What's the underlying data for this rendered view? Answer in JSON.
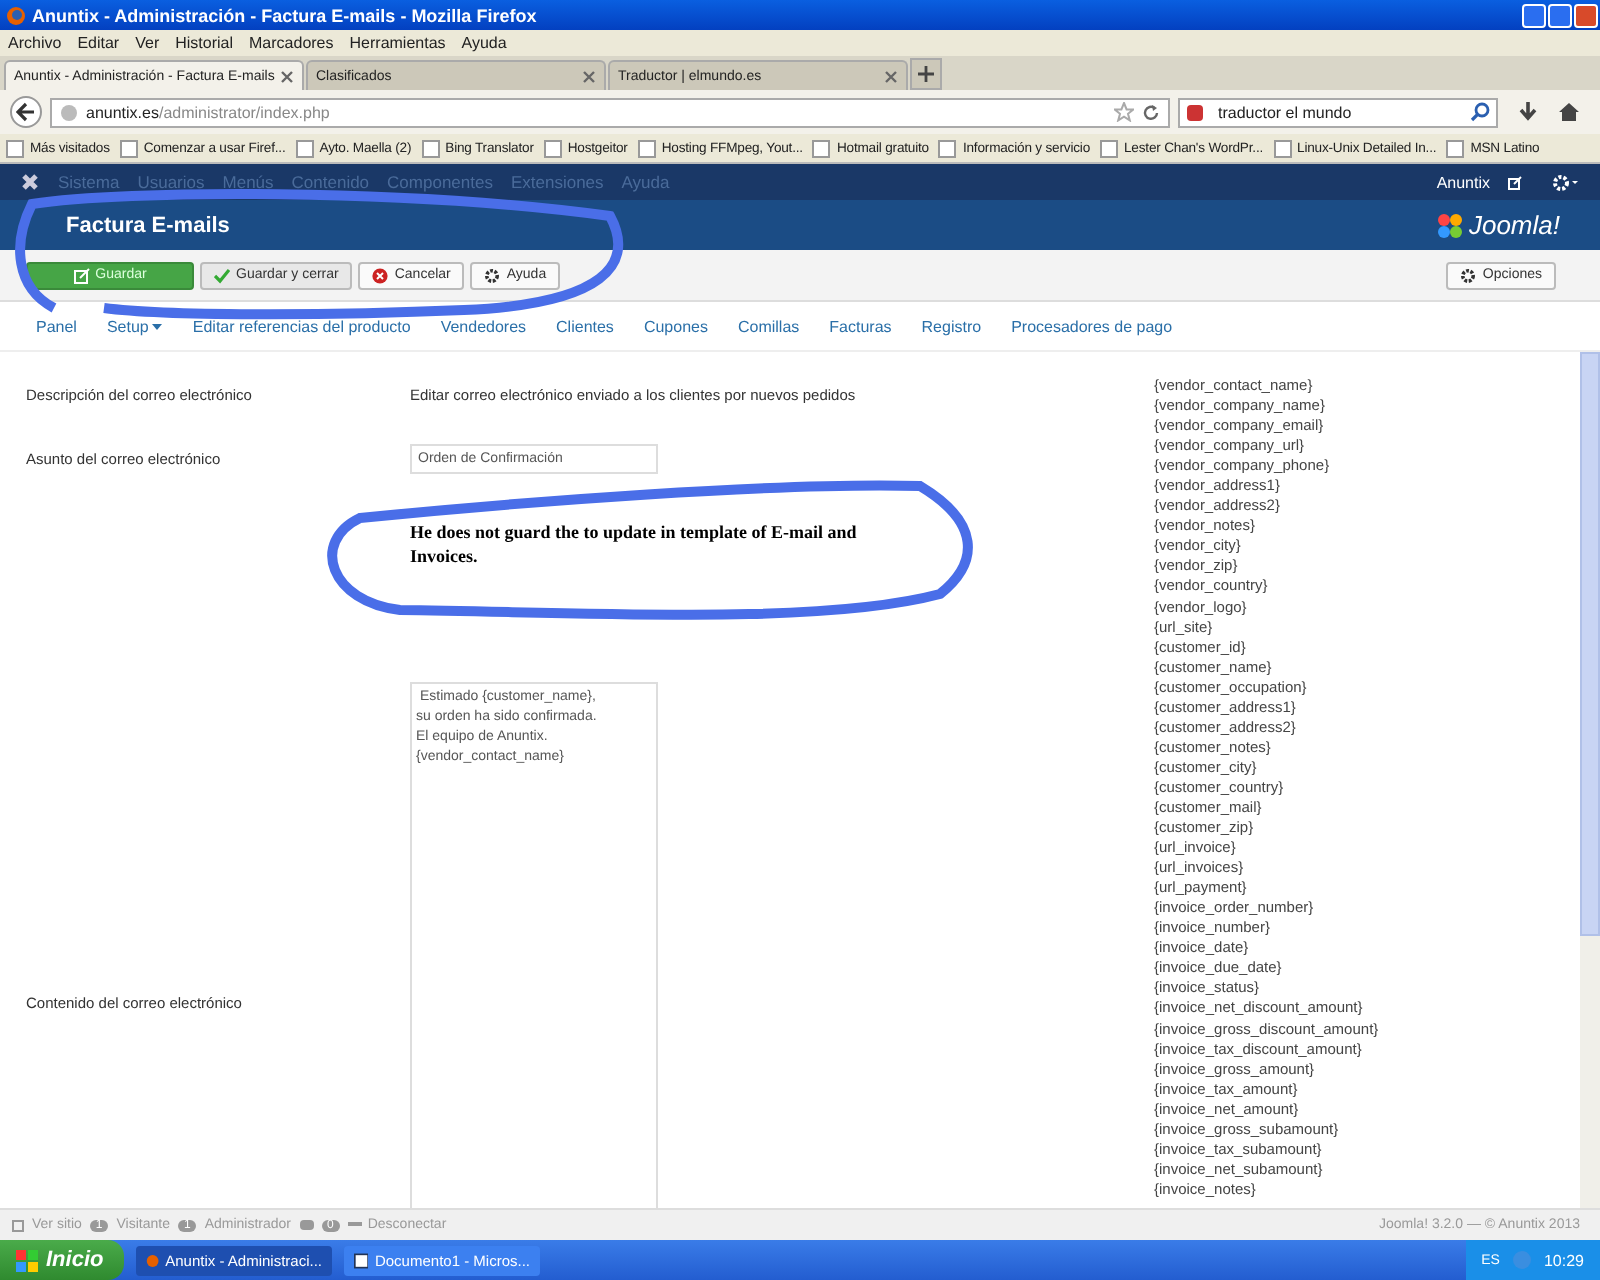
{
  "window": {
    "title": "Anuntix - Administración - Factura E-mails - Mozilla Firefox"
  },
  "menubar": [
    "Archivo",
    "Editar",
    "Ver",
    "Historial",
    "Marcadores",
    "Herramientas",
    "Ayuda"
  ],
  "browser_tabs": [
    {
      "label": "Anuntix - Administración - Factura E-mails",
      "selected": true
    },
    {
      "label": "Clasificados",
      "selected": false
    },
    {
      "label": "Traductor | elmundo.es",
      "selected": false
    }
  ],
  "address_bar": {
    "host": "anuntix.es",
    "path": "/administrator/index.php"
  },
  "search_field": {
    "value": "traductor el mundo"
  },
  "bookmarks": [
    "Más visitados",
    "Comenzar a usar Firef...",
    "Ayto. Maella (2)",
    "Bing Translator",
    "Hostgeitor",
    "Hosting FFMpeg, Yout...",
    "Hotmail gratuito",
    "Información y servicio",
    "Lester Chan's WordPr...",
    "Linux-Unix Detailed In...",
    "MSN Latino"
  ],
  "admin_menu": [
    "Sistema",
    "Usuarios",
    "Menús",
    "Contenido",
    "Componentes",
    "Extensiones",
    "Ayuda"
  ],
  "admin_user": "Anuntix",
  "page_title": "Factura E-mails",
  "brand": "Joomla!",
  "toolbar": [
    {
      "label": "Guardar",
      "kind": "save"
    },
    {
      "label": "Guardar y cerrar",
      "kind": "save-close"
    },
    {
      "label": "Cancelar",
      "kind": "cancel"
    },
    {
      "label": "Ayuda",
      "kind": "help"
    }
  ],
  "options_button": "Opciones",
  "subnav": [
    {
      "label": "Panel",
      "dropdown": false
    },
    {
      "label": "Setup",
      "dropdown": true
    },
    {
      "label": "Editar referencias del producto",
      "dropdown": false
    },
    {
      "label": "Vendedores",
      "dropdown": false
    },
    {
      "label": "Clientes",
      "dropdown": false
    },
    {
      "label": "Cupones",
      "dropdown": false
    },
    {
      "label": "Comillas",
      "dropdown": false
    },
    {
      "label": "Facturas",
      "dropdown": false
    },
    {
      "label": "Registro",
      "dropdown": false
    },
    {
      "label": "Procesadores de pago",
      "dropdown": false
    }
  ],
  "form": {
    "description": {
      "label": "Descripción del correo electrónico",
      "value": "Editar correo electrónico enviado a los clientes por nuevos pedidos"
    },
    "subject": {
      "label": "Asunto del correo electrónico",
      "value": "Orden de Confirmación"
    },
    "content": {
      "label": "Contenido del correo electrónico",
      "value": " Estimado {customer_name},\nsu orden ha sido confirmada.\nEl equipo de Anuntix.\n{vendor_contact_name}"
    }
  },
  "annotation": "He does not guard the to update in template of E-mail and Invoices.",
  "variables": [
    "{vendor_contact_name}",
    "{vendor_company_name}",
    "{vendor_company_email}",
    "{vendor_company_url}",
    "{vendor_company_phone}",
    "{vendor_address1}",
    "{vendor_address2}",
    "{vendor_notes}",
    "{vendor_city}",
    "{vendor_zip}",
    "{vendor_country}",
    "{vendor_logo}",
    "{url_site}",
    "{customer_id}",
    "{customer_name}",
    "{customer_occupation}",
    "{customer_address1}",
    "{customer_address2}",
    "{customer_notes}",
    "{customer_city}",
    "{customer_country}",
    "{customer_mail}",
    "{customer_zip}",
    "{url_invoice}",
    "{url_invoices}",
    "{url_payment}",
    "{invoice_order_number}",
    "{invoice_number}",
    "{invoice_date}",
    "{invoice_due_date}",
    "{invoice_status}",
    "{invoice_net_discount_amount}",
    "{invoice_gross_discount_amount}",
    "{invoice_tax_discount_amount}",
    "{invoice_gross_amount}",
    "{invoice_tax_amount}",
    "{invoice_net_amount}",
    "{invoice_gross_subamount}",
    "{invoice_tax_subamount}",
    "{invoice_net_subamount}",
    "{invoice_notes}"
  ],
  "status_bar": {
    "view_site": "Ver sitio",
    "visitors": "1",
    "visitors_label": "Visitante",
    "admins": "1",
    "admins_label": "Administrador",
    "messages": "0",
    "logout": "Desconectar",
    "version": "Joomla! 3.2.0 — © Anuntix 2013"
  },
  "taskbar": {
    "start": "Inicio",
    "tasks": [
      {
        "label": "Anuntix - Administraci...",
        "selected": true
      },
      {
        "label": "Documento1 - Micros...",
        "selected": false
      }
    ],
    "language": "ES",
    "clock": "10:29"
  }
}
